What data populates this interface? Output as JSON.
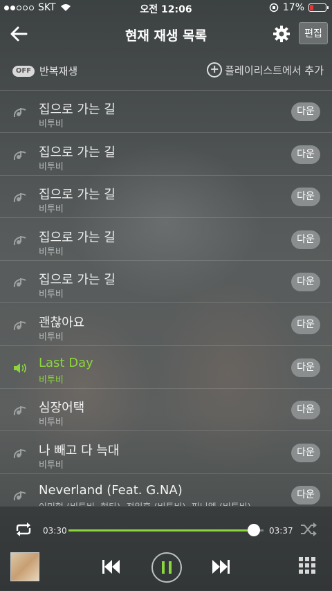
{
  "status_bar": {
    "carrier": "SKT",
    "time": "오전 12:06",
    "battery_percent": "17%",
    "signal_bars": 2
  },
  "header": {
    "title": "현재 재생 목록",
    "edit_label": "편집",
    "back_icon": "back-arrow-icon",
    "settings_icon": "gear-icon"
  },
  "options": {
    "toggle_label": "OFF",
    "repeat_label": "반복재생",
    "add_playlist_label": "플레이리스트에서 추가"
  },
  "playlist": [
    {
      "title": "집으로 가는 길",
      "artist": "비투비",
      "action": "다운",
      "active": false
    },
    {
      "title": "집으로 가는 길",
      "artist": "비투비",
      "action": "다운",
      "active": false
    },
    {
      "title": "집으로 가는 길",
      "artist": "비투비",
      "action": "다운",
      "active": false
    },
    {
      "title": "집으로 가는 길",
      "artist": "비투비",
      "action": "다운",
      "active": false
    },
    {
      "title": "집으로 가는 길",
      "artist": "비투비",
      "action": "다운",
      "active": false
    },
    {
      "title": "괜찮아요",
      "artist": "비투비",
      "action": "다운",
      "active": false
    },
    {
      "title": "Last Day",
      "artist": "비투비",
      "action": "다운",
      "active": true
    },
    {
      "title": "심장어택",
      "artist": "비투비",
      "action": "다운",
      "active": false
    },
    {
      "title": "나 빼고 다 늑대",
      "artist": "비투비",
      "action": "다운",
      "active": false
    },
    {
      "title": "Neverland (Feat. G.NA)",
      "artist": "이민혁 (비투비, 현타), 정일훈 (비투비), 피니엘 (비투비)",
      "action": "다운",
      "active": false
    }
  ],
  "player": {
    "current_time": "03:30",
    "total_time": "03:37",
    "progress_fraction": 0.95,
    "accent_color": "#8cd63d"
  }
}
